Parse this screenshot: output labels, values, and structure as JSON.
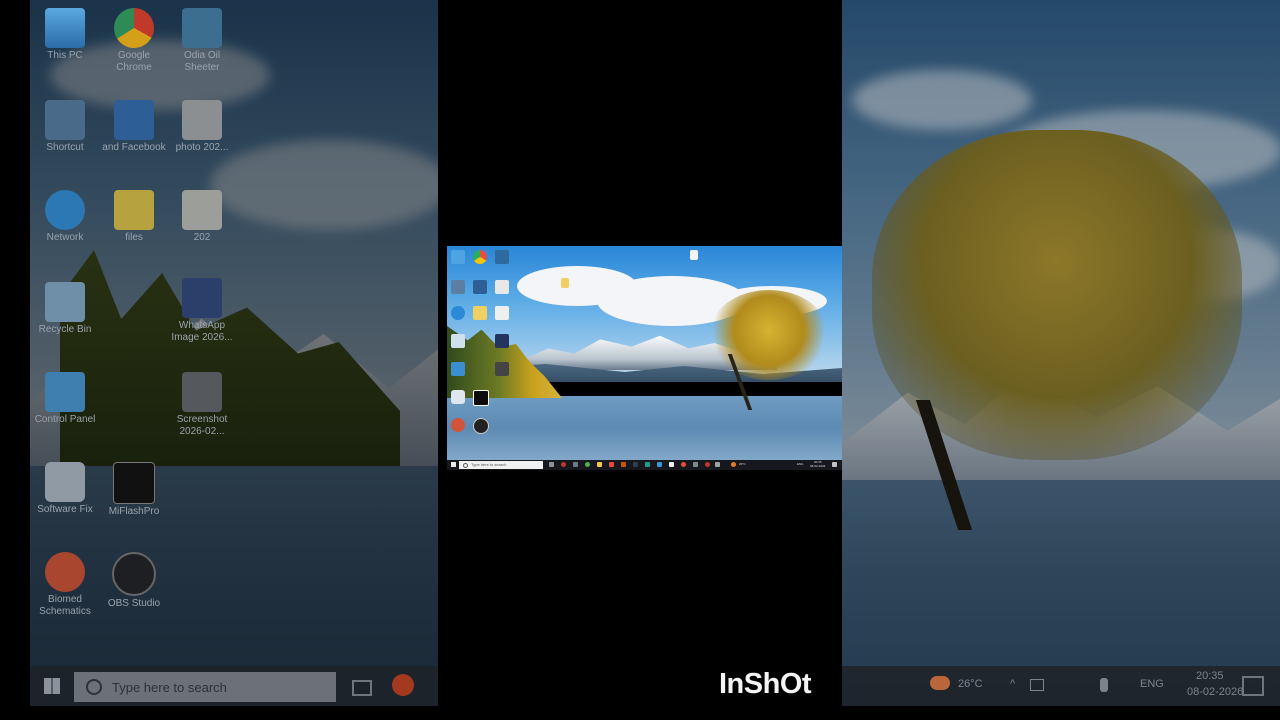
{
  "left_panel": {
    "icons": [
      {
        "label": "This PC",
        "icon": "monitor-icon"
      },
      {
        "label": "Google Chrome",
        "icon": "chrome-icon"
      },
      {
        "label": "Odia Oil Sheeter",
        "icon": "app-icon"
      },
      {
        "label": "Shortcut",
        "icon": "shortcut-icon"
      },
      {
        "label": "and Facebook",
        "icon": "app-icon"
      },
      {
        "label": "photo 202...",
        "icon": "image-icon"
      },
      {
        "label": "Network",
        "icon": "network-icon"
      },
      {
        "label": "files",
        "icon": "folder-icon"
      },
      {
        "label": "202",
        "icon": "document-icon"
      },
      {
        "label": "Recycle Bin",
        "icon": "recycle-bin-icon"
      },
      {
        "label": "WhatsApp Image 2026...",
        "icon": "image-icon"
      },
      {
        "label": "Control Panel",
        "icon": "control-panel-icon"
      },
      {
        "label": "Screenshot 2026-02...",
        "icon": "image-icon"
      },
      {
        "label": "Software Fix",
        "icon": "wrench-icon"
      },
      {
        "label": "MiFlashPro",
        "icon": "app-icon"
      },
      {
        "label": "Biomed Schematics",
        "icon": "app-icon"
      },
      {
        "label": "OBS Studio",
        "icon": "obs-icon"
      }
    ],
    "search_placeholder": "Type here to search"
  },
  "right_panel": {
    "weather": "26°C",
    "language": "ENG",
    "time": "20:35",
    "date": "08-02-2026"
  },
  "desktop": {
    "search_placeholder": "Type here to search",
    "weather": "26°C",
    "language": "ENG",
    "time": "20:35",
    "date": "08-02-2026"
  },
  "watermark": "InShOt",
  "colors": {
    "taskbar": "#16181d",
    "sky": "#2a86d8",
    "foliage": "#d6b332"
  }
}
